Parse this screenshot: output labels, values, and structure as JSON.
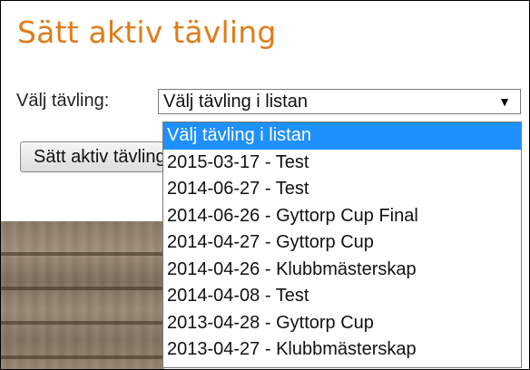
{
  "page": {
    "title": "Sätt aktiv tävling",
    "select_label": "Välj tävling:",
    "select_value": "Välj tävling i listan",
    "select_arrow": "▼",
    "button_label": "Sätt aktiv tävling"
  },
  "dropdown": {
    "options": [
      "Välj tävling i listan",
      "2015-03-17 - Test",
      "2014-06-27 - Test",
      "2014-06-26 - Gyttorp Cup Final",
      "2014-04-27 - Gyttorp Cup",
      "2014-04-26 - Klubbmästerskap",
      "2014-04-08 - Test",
      "2013-04-28 - Gyttorp Cup",
      "2013-04-27 - Klubbmästerskap"
    ],
    "selected_index": 0
  },
  "colors": {
    "title": "#e07c1a",
    "highlight": "#1e90ff"
  }
}
